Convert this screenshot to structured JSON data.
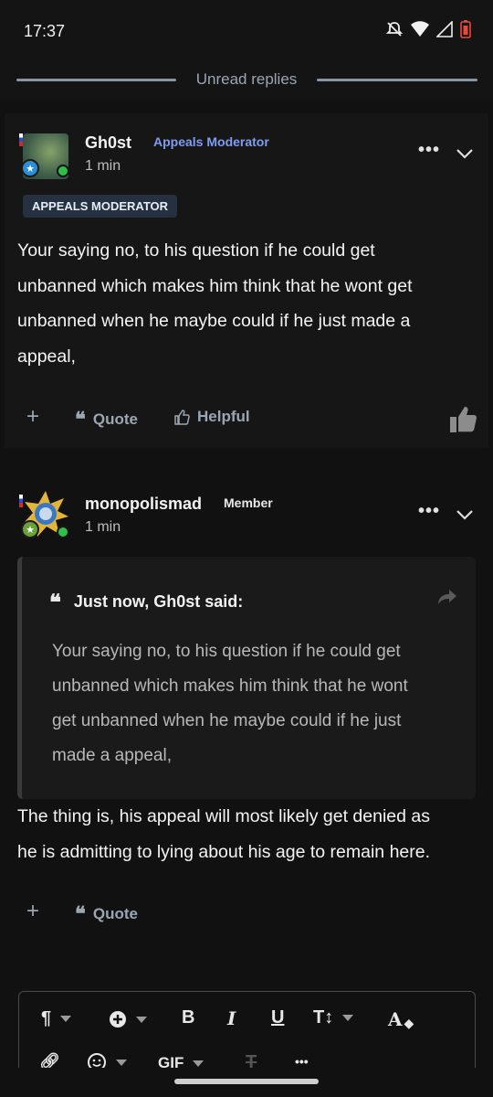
{
  "status_bar": {
    "time": "17:37"
  },
  "divider": {
    "label": "Unread replies"
  },
  "post1": {
    "username": "Gh0st",
    "role": "Appeals Moderator",
    "time_ago": "1 min",
    "role_badge": "APPEALS MODERATOR",
    "body_lines": [
      "Your saying no, to his question if he could get",
      "unbanned which makes him think that he wont get",
      "unbanned when he maybe could if he just made a",
      "appeal,"
    ],
    "actions": {
      "quote": "Quote",
      "helpful": "Helpful"
    }
  },
  "post2": {
    "username": "monopolismad",
    "role": "Member",
    "time_ago": "1 min",
    "quote": {
      "header": "Just now, Gh0st said:",
      "lines": [
        "Your saying no, to his question if he could get",
        "unbanned which makes him think that he wont",
        "get unbanned when he maybe could if he just",
        "made a appeal,"
      ]
    },
    "body_lines": [
      "The thing is, his appeal will most likely get denied as",
      "he is admitting to lying about his age to remain here."
    ],
    "actions": {
      "quote": "Quote"
    }
  },
  "editor": {
    "toolbar_row1": [
      "paragraph",
      "insert",
      "bold",
      "italic",
      "underline",
      "text-size",
      "text-color"
    ],
    "toolbar_row2": [
      "link",
      "emoji",
      "gif",
      "clear-format",
      "more"
    ],
    "bold_label": "B",
    "italic_label": "I",
    "underline_label": "U",
    "size_label": "T↕",
    "color_label": "A",
    "gif_label": "GIF",
    "more_label": "•••"
  },
  "colors": {
    "accent": "#7f9cf5",
    "online": "#2fbf4a",
    "muted": "#9aa6b4"
  }
}
